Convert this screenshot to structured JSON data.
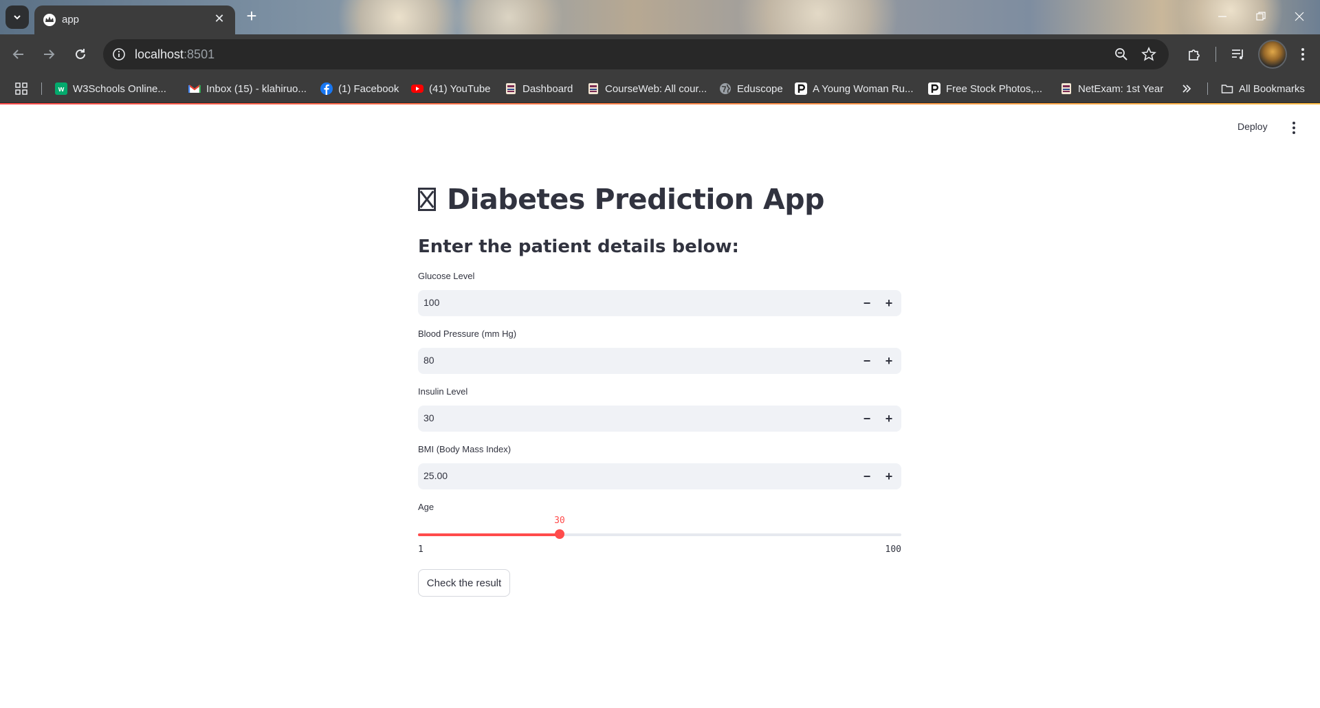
{
  "browser": {
    "tab_title": "app",
    "url_host": "localhost",
    "url_port": ":8501",
    "bookmarks": [
      {
        "label": "W3Schools Online...",
        "icon": "w3schools-icon"
      },
      {
        "label": "Inbox (15) - klahiruo...",
        "icon": "gmail-icon"
      },
      {
        "label": "(1) Facebook",
        "icon": "facebook-icon"
      },
      {
        "label": "(41) YouTube",
        "icon": "youtube-icon"
      },
      {
        "label": "Dashboard",
        "icon": "university-icon"
      },
      {
        "label": "CourseWeb: All cour...",
        "icon": "university-icon"
      },
      {
        "label": "Eduscope",
        "icon": "globe-icon"
      },
      {
        "label": "A Young Woman Ru...",
        "icon": "pexels-icon"
      },
      {
        "label": "Free Stock Photos,...",
        "icon": "pexels-icon"
      },
      {
        "label": "NetExam: 1st Year",
        "icon": "university-icon"
      }
    ],
    "all_bookmarks": "All Bookmarks"
  },
  "app": {
    "deploy_label": "Deploy",
    "title": "Diabetes Prediction App",
    "subtitle": "Enter the patient details below:",
    "fields": [
      {
        "label": "Glucose Level",
        "value": "100"
      },
      {
        "label": "Blood Pressure (mm Hg)",
        "value": "80"
      },
      {
        "label": "Insulin Level",
        "value": "30"
      },
      {
        "label": "BMI (Body Mass Index)",
        "value": "25.00"
      }
    ],
    "age": {
      "label": "Age",
      "value": 30,
      "min": 1,
      "max": 100,
      "value_text": "30",
      "min_text": "1",
      "max_text": "100"
    },
    "button_label": "Check the result",
    "accent_color": "#ff4b4b"
  }
}
